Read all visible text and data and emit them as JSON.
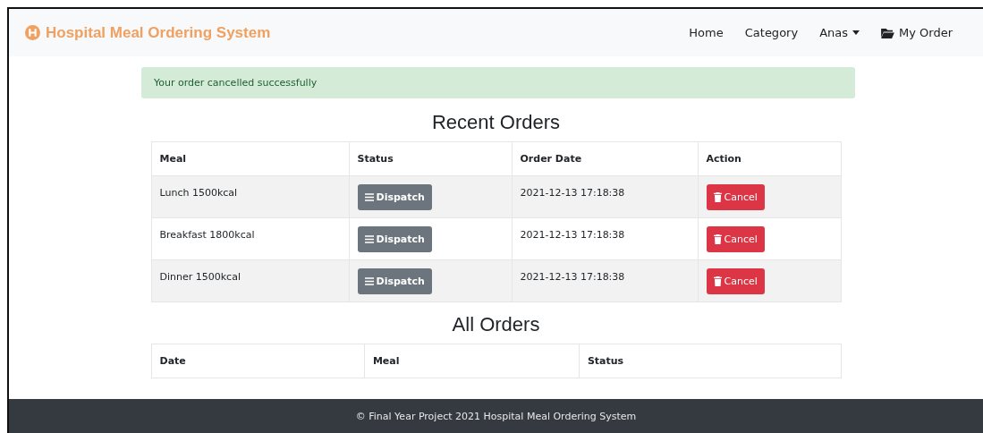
{
  "navbar": {
    "brand": "Hospital Meal Ordering System",
    "links": [
      {
        "label": "Home",
        "kind": "plain"
      },
      {
        "label": "Category",
        "kind": "plain"
      },
      {
        "label": "Anas",
        "kind": "dropdown"
      },
      {
        "label": "My Order",
        "kind": "folder"
      }
    ]
  },
  "alert": {
    "message": "Your order cancelled successfully"
  },
  "recent_orders": {
    "title": "Recent Orders",
    "columns": [
      "Meal",
      "Status",
      "Order Date",
      "Action"
    ],
    "rows": [
      {
        "meal": "Lunch 1500kcal",
        "status": "Dispatch",
        "order_date": "2021-12-13 17:18:38",
        "action": "Cancel"
      },
      {
        "meal": "Breakfast 1800kcal",
        "status": "Dispatch",
        "order_date": "2021-12-13 17:18:38",
        "action": "Cancel"
      },
      {
        "meal": "Dinner 1500kcal",
        "status": "Dispatch",
        "order_date": "2021-12-13 17:18:38",
        "action": "Cancel"
      }
    ]
  },
  "all_orders": {
    "title": "All Orders",
    "columns": [
      "Date",
      "Meal",
      "Status"
    ]
  },
  "footer": {
    "text": "© Final Year Project 2021 Hospital Meal Ordering System"
  }
}
